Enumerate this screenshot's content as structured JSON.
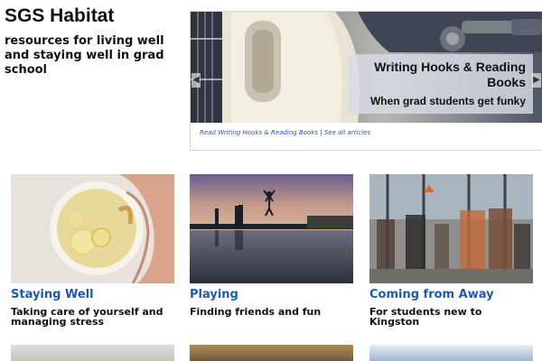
{
  "site": {
    "title": "SGS Habitat",
    "tagline": "resources for living well and staying well in grad school"
  },
  "carousel": {
    "caption_title": "Writing Hooks & Reading Books",
    "caption_subtitle": "When grad students get funky",
    "read_link": "Read Writing Hooks & Reading Books",
    "separator": "|",
    "see_all_link": "See all articles",
    "prev_icon": "chevron-left-icon",
    "next_icon": "chevron-right-icon"
  },
  "cards": [
    {
      "title": "Staying Well",
      "description": "Taking care of yourself and managing stress"
    },
    {
      "title": "Playing",
      "description": "Finding friends and fun"
    },
    {
      "title": "Coming from Away",
      "description": "For students new to Kingston"
    }
  ],
  "colors": {
    "link": "#1f5aa8",
    "text": "#111111",
    "caption_panel": "#d7dce4"
  }
}
